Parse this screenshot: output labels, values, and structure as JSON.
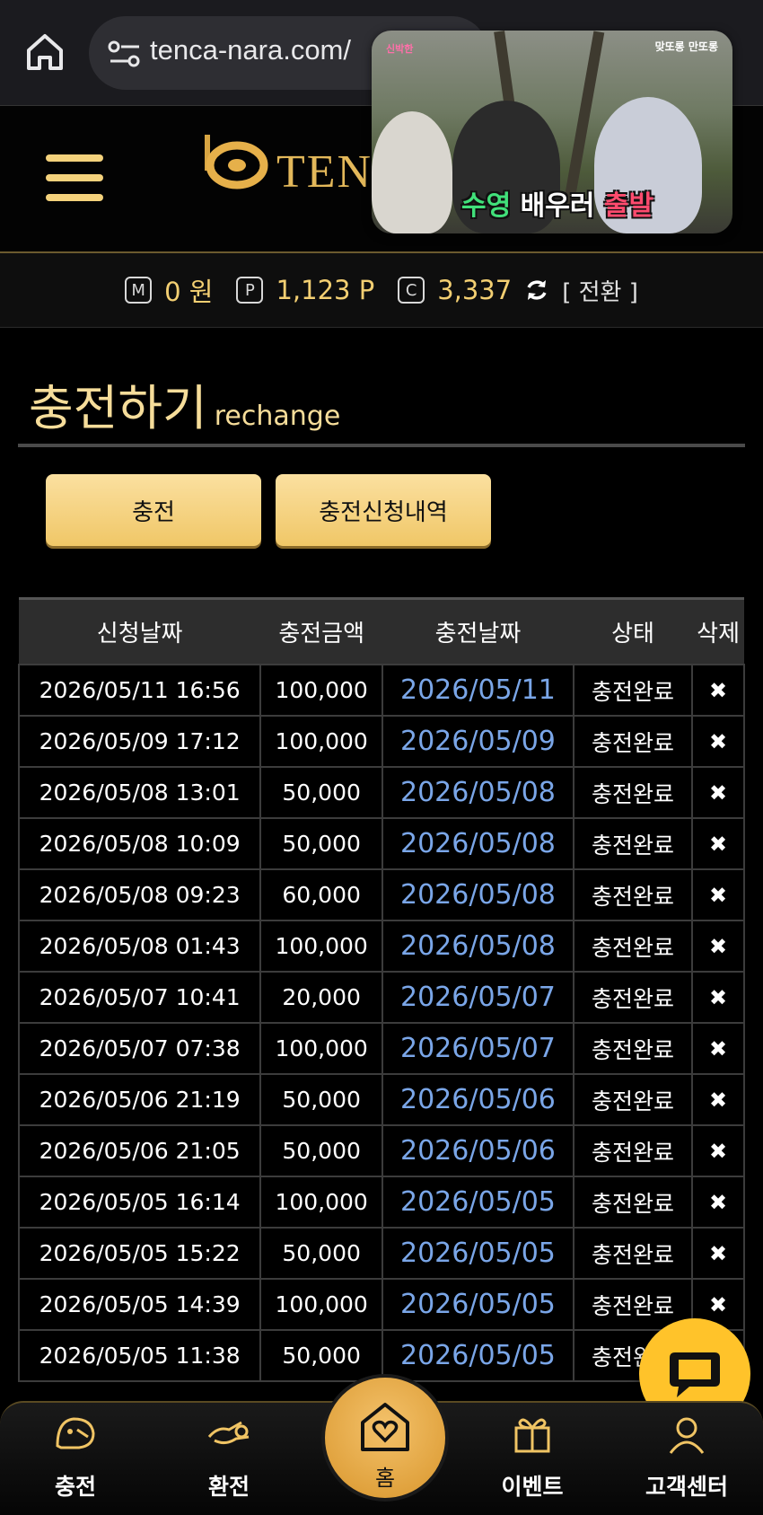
{
  "browser": {
    "url": "tenca-nara.com/"
  },
  "header": {
    "logo_text": "TEN"
  },
  "video": {
    "caption_1": "수영",
    "caption_2": "배우러",
    "caption_3": "출발",
    "badge_left": "신박한",
    "badge_right": "맞또롱 만또롱"
  },
  "balance": {
    "money_icon": "M",
    "money": "0 원",
    "point_icon": "P",
    "points": "1,123 P",
    "coin_icon": "C",
    "coins": "3,337",
    "convert_label": "[ 전환 ]"
  },
  "page": {
    "title": "충전하기",
    "subtitle": "rechange"
  },
  "actions": {
    "charge_label": "충전",
    "history_label": "충전신청내역"
  },
  "table": {
    "headers": [
      "신청날짜",
      "충전금액",
      "충전날짜",
      "상태",
      "삭제"
    ],
    "rows": [
      {
        "requested": "2026/05/11 16:56",
        "amount": "100,000",
        "charged": "2026/05/11",
        "status": "충전완료",
        "delete": "✖"
      },
      {
        "requested": "2026/05/09 17:12",
        "amount": "100,000",
        "charged": "2026/05/09",
        "status": "충전완료",
        "delete": "✖"
      },
      {
        "requested": "2026/05/08 13:01",
        "amount": "50,000",
        "charged": "2026/05/08",
        "status": "충전완료",
        "delete": "✖"
      },
      {
        "requested": "2026/05/08 10:09",
        "amount": "50,000",
        "charged": "2026/05/08",
        "status": "충전완료",
        "delete": "✖"
      },
      {
        "requested": "2026/05/08 09:23",
        "amount": "60,000",
        "charged": "2026/05/08",
        "status": "충전완료",
        "delete": "✖"
      },
      {
        "requested": "2026/05/08 01:43",
        "amount": "100,000",
        "charged": "2026/05/08",
        "status": "충전완료",
        "delete": "✖"
      },
      {
        "requested": "2026/05/07 10:41",
        "amount": "20,000",
        "charged": "2026/05/07",
        "status": "충전완료",
        "delete": "✖"
      },
      {
        "requested": "2026/05/07 07:38",
        "amount": "100,000",
        "charged": "2026/05/07",
        "status": "충전완료",
        "delete": "✖"
      },
      {
        "requested": "2026/05/06 21:19",
        "amount": "50,000",
        "charged": "2026/05/06",
        "status": "충전완료",
        "delete": "✖"
      },
      {
        "requested": "2026/05/06 21:05",
        "amount": "50,000",
        "charged": "2026/05/06",
        "status": "충전완료",
        "delete": "✖"
      },
      {
        "requested": "2026/05/05 16:14",
        "amount": "100,000",
        "charged": "2026/05/05",
        "status": "충전완료",
        "delete": "✖"
      },
      {
        "requested": "2026/05/05 15:22",
        "amount": "50,000",
        "charged": "2026/05/05",
        "status": "충전완료",
        "delete": "✖"
      },
      {
        "requested": "2026/05/05 14:39",
        "amount": "100,000",
        "charged": "2026/05/05",
        "status": "충전완료",
        "delete": "✖"
      },
      {
        "requested": "2026/05/05 11:38",
        "amount": "50,000",
        "charged": "2026/05/05",
        "status": "충전완료",
        "delete": "✖"
      }
    ]
  },
  "nav": {
    "charge": "충전",
    "exchange": "환전",
    "home": "홈",
    "event": "이벤트",
    "support": "고객센터"
  },
  "colors": {
    "accent_gold": "#f3cf72",
    "link_blue": "#7aa6e8",
    "fab_yellow": "#ffc32a"
  }
}
